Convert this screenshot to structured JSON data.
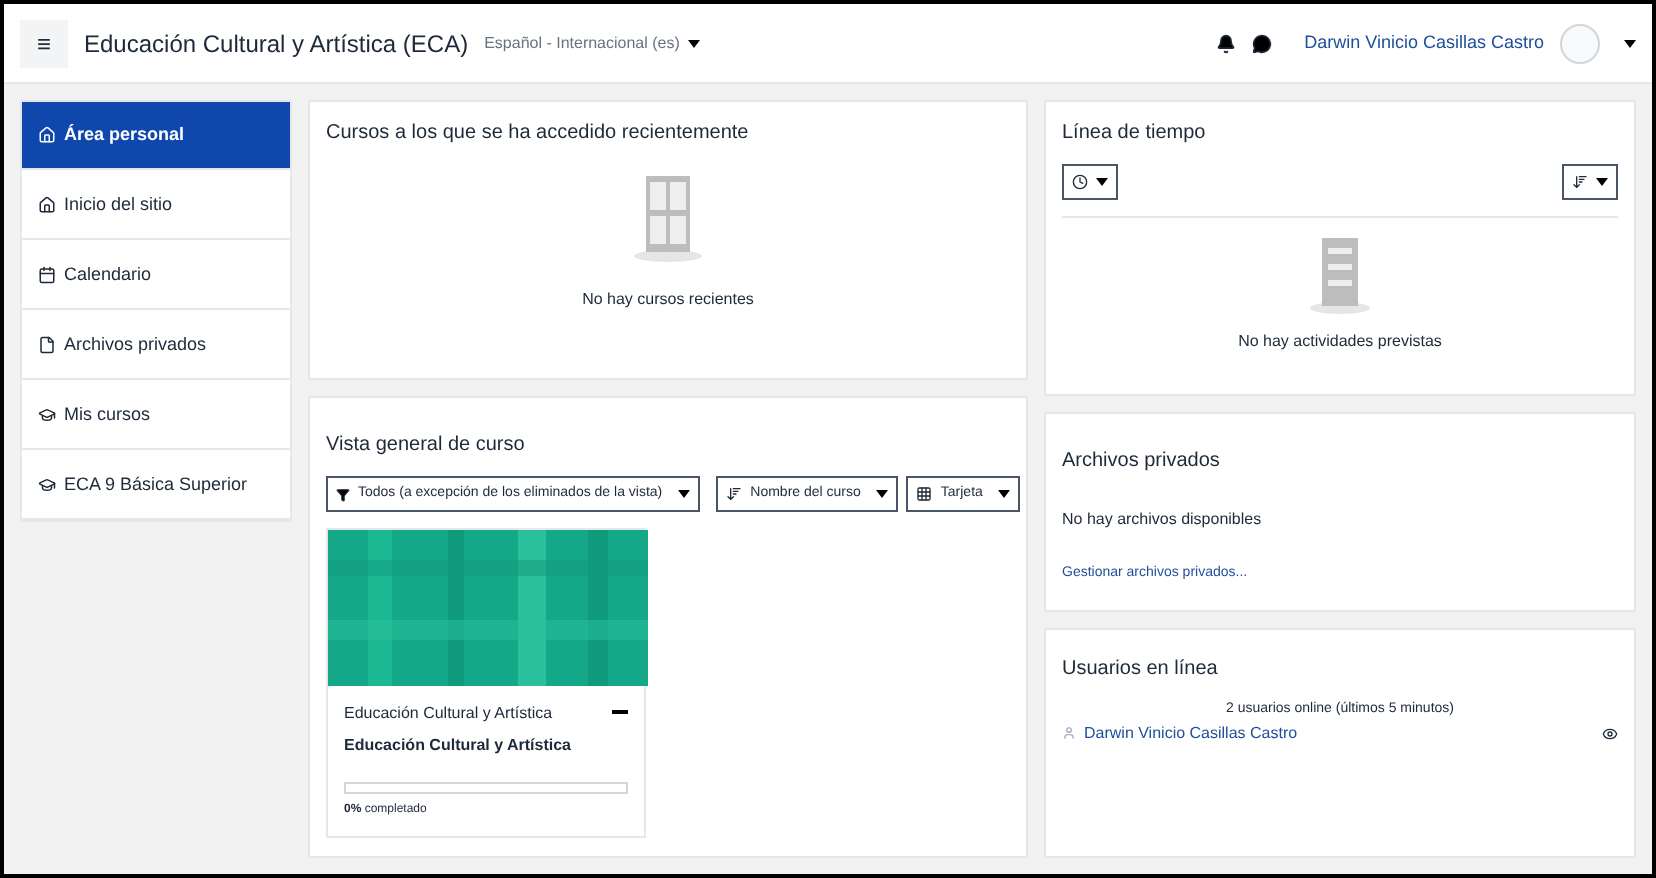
{
  "header": {
    "menu_icon": "≡",
    "site_title": "Educación Cultural y Artística (ECA)",
    "language": "Español - Internacional (es)",
    "user_name": "Darwin Vinicio Casillas Castro"
  },
  "sidebar": {
    "items": [
      {
        "label": "Área personal",
        "selected": true,
        "kind": "home"
      },
      {
        "label": "Inicio del sitio",
        "selected": false,
        "kind": "house"
      },
      {
        "label": "Calendario",
        "selected": false,
        "kind": "calendar"
      },
      {
        "label": "Archivos privados",
        "selected": false,
        "kind": "file"
      },
      {
        "label": "Mis cursos",
        "selected": false,
        "kind": "course"
      },
      {
        "label": "ECA 9 Básica Superior",
        "selected": false,
        "kind": "course"
      }
    ]
  },
  "recent": {
    "title": "Cursos a los que se ha accedido recientemente",
    "empty": "No hay cursos recientes"
  },
  "overview": {
    "title": "Vista general de curso",
    "filter": "Todos (a excepción de los eliminados de la vista)",
    "sort": "Nombre del curso",
    "view": "Tarjeta",
    "courses": [
      {
        "category": "Educación Cultural y Artística",
        "name": "Educación Cultural y Artística",
        "level": 0,
        "progress": "**0%** completado"
      }
    ]
  },
  "timeline": {
    "title": "Línea de tiempo",
    "empty": "No hay actividades previstas"
  },
  "private_files": {
    "title": "Archivos privados",
    "empty": "No hay archivos disponibles",
    "link": "Gestionar archivos privados..."
  },
  "online_users": {
    "title": "Usuarios en línea",
    "summary": "2 usuarios online (últimos 5 minutos)",
    "users": [
      "Darwin Vinicio Casillas Castro"
    ]
  }
}
